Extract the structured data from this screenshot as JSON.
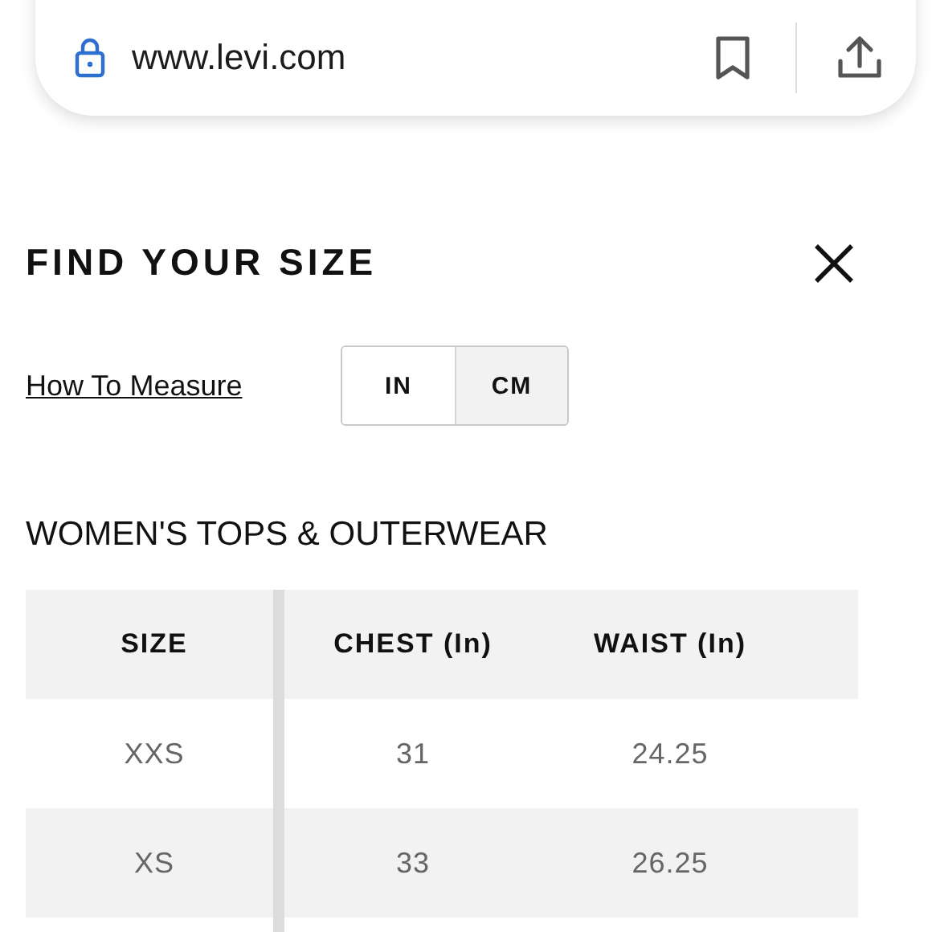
{
  "address_bar": {
    "url": "www.levi.com"
  },
  "dialog": {
    "title": "FIND YOUR SIZE",
    "how_to_measure": "How To Measure",
    "units": [
      {
        "label": "IN",
        "selected": true
      },
      {
        "label": "CM",
        "selected": false
      }
    ]
  },
  "section_title": "WOMEN'S TOPS & OUTERWEAR",
  "table": {
    "columns": [
      "SIZE",
      "CHEST (In)",
      "WAIST (In)"
    ],
    "rows": [
      [
        "XXS",
        "31",
        "24.25"
      ],
      [
        "XS",
        "33",
        "26.25"
      ]
    ]
  }
}
